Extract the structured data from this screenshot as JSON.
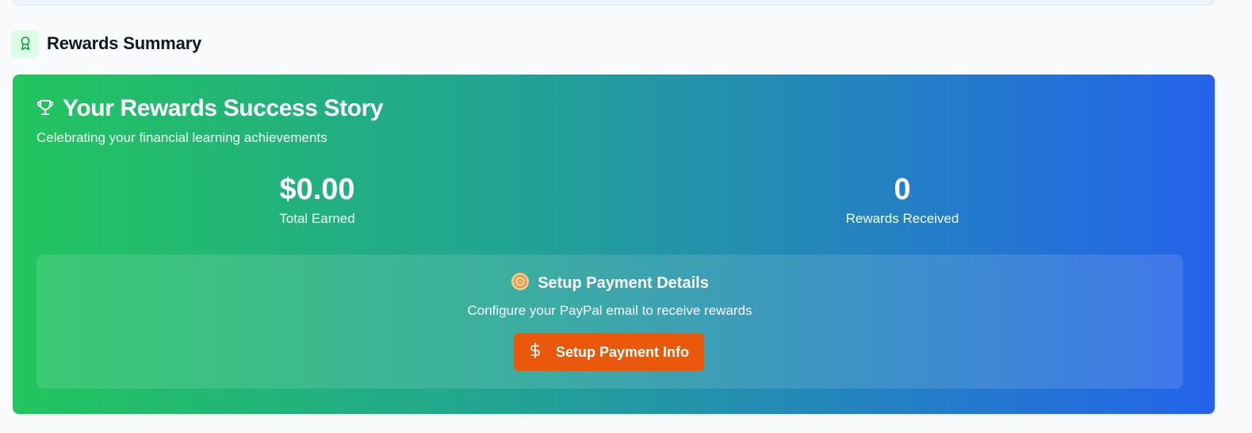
{
  "section": {
    "title": "Rewards Summary",
    "icon": "award-ribbon-icon",
    "icon_color": "#16a34a"
  },
  "card": {
    "title": "Your Rewards Success Story",
    "title_icon": "trophy-icon",
    "subtitle": "Celebrating your financial learning achievements",
    "gradient": [
      "#22c55e",
      "#2563eb"
    ]
  },
  "stats": [
    {
      "value": "$0.00",
      "label": "Total Earned"
    },
    {
      "value": "0",
      "label": "Rewards Received"
    }
  ],
  "payment": {
    "title": "Setup Payment Details",
    "icon": "target-icon",
    "description": "Configure your PayPal email to receive rewards",
    "button_label": "Setup Payment Info",
    "button_icon": "dollar-icon",
    "button_color": "#ea580c"
  }
}
